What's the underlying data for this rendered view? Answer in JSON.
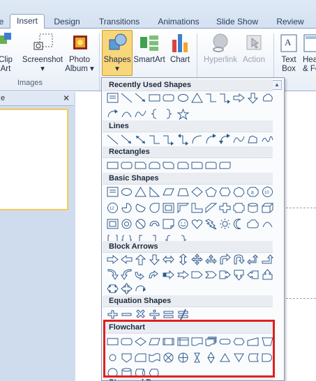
{
  "tabs": [
    {
      "label": "e",
      "active": false
    },
    {
      "label": "Insert",
      "active": true
    },
    {
      "label": "Design",
      "active": false
    },
    {
      "label": "Transitions",
      "active": false
    },
    {
      "label": "Animations",
      "active": false
    },
    {
      "label": "Slide Show",
      "active": false
    },
    {
      "label": "Review",
      "active": false
    }
  ],
  "ribbon": {
    "clip_art": {
      "line1": "Clip",
      "line2": "Art"
    },
    "screenshot": {
      "line1": "Screenshot",
      "line2": "▾"
    },
    "photo_album": {
      "line1": "Photo",
      "line2": "Album ▾"
    },
    "shapes": {
      "line1": "Shapes",
      "line2": "▾"
    },
    "smartart": {
      "label": "SmartArt"
    },
    "chart": {
      "label": "Chart"
    },
    "hyperlink": {
      "label": "Hyperlink"
    },
    "action": {
      "label": "Action"
    },
    "text_box": {
      "line1": "Text",
      "line2": "Box"
    },
    "header_footer": {
      "line1": "Header",
      "line2": "& Fo"
    },
    "images_group_label": "Images"
  },
  "left_panel": {
    "tab_label": "e",
    "close_glyph": "✕"
  },
  "dropdown": {
    "sections": [
      {
        "title": "Recently Used Shapes",
        "rows": [
          [
            "textbox",
            "line",
            "arrow-line",
            "rect",
            "rounded-rect",
            "oval",
            "triangle",
            "elbow",
            "elbow-arrow",
            "right-arrow",
            "down-arrow",
            "pentagon-ish"
          ],
          [
            "curve-arrow",
            "arc",
            "curve",
            "left-brace",
            "right-brace",
            "star"
          ]
        ]
      },
      {
        "title": "Lines",
        "rows": [
          [
            "line",
            "arrow-line",
            "double-arrow-line",
            "elbow",
            "elbow-arrow",
            "elbow-double",
            "curved-connector",
            "curved-arrow",
            "curved-double",
            "curve",
            "freeform",
            "scribble"
          ]
        ]
      },
      {
        "title": "Rectangles",
        "rows": [
          [
            "rect",
            "rounded-rect",
            "snip1",
            "snip2",
            "snip-diag",
            "snip-round",
            "round1",
            "round2",
            "round-diag"
          ]
        ]
      },
      {
        "title": "Basic Shapes",
        "rows": [
          [
            "textbox",
            "oval",
            "triangle",
            "right-triangle",
            "parallelogram",
            "trapezoid",
            "diamond",
            "pentagon",
            "hexagon",
            "heptagon",
            "octagon",
            "decagon"
          ],
          [
            "dodecagon",
            "pie",
            "chord",
            "teardrop",
            "frame",
            "half-frame",
            "l-shape",
            "diag-stripe",
            "cross",
            "plaque",
            "can",
            "cube"
          ],
          [
            "bevel",
            "donut",
            "no-symbol",
            "block-arc",
            "folded-corner",
            "smiley",
            "heart",
            "lightning",
            "sun",
            "moon",
            "cloud",
            "arc"
          ],
          [
            "double-bracket",
            "double-brace",
            "left-bracket",
            "right-bracket",
            "left-brace",
            "right-brace"
          ]
        ]
      },
      {
        "title": "Block Arrows",
        "rows": [
          [
            "right-arrow",
            "left-arrow",
            "up-arrow",
            "down-arrow",
            "left-right-arrow",
            "up-down-arrow",
            "quad-arrow",
            "left-right-up",
            "bent-arrow",
            "u-turn",
            "left-up-arrow",
            "bent-up-arrow"
          ],
          [
            "curved-right",
            "curved-left",
            "curved-up",
            "curved-down",
            "striped-right",
            "notched-right",
            "pentagon-arrow",
            "chevron",
            "right-callout",
            "down-callout",
            "left-callout",
            "up-callout"
          ],
          [
            "lr-callout",
            "quad-callout",
            "circular-arrow"
          ]
        ]
      },
      {
        "title": "Equation Shapes",
        "rows": [
          [
            "plus",
            "minus",
            "multiply",
            "divide",
            "equal",
            "not-equal"
          ]
        ]
      },
      {
        "title": "Flowchart",
        "rows": [
          [
            "process",
            "alt-process",
            "decision",
            "data",
            "predefined",
            "internal-storage",
            "document",
            "multidocument",
            "terminator",
            "preparation",
            "manual-input",
            "manual-operation"
          ],
          [
            "connector",
            "offpage",
            "card",
            "punched-tape",
            "summing",
            "or",
            "collate",
            "sort",
            "extract",
            "merge",
            "stored-data",
            "delay"
          ],
          [
            "seq-storage",
            "magnetic-disk",
            "direct-storage",
            "display"
          ]
        ]
      },
      {
        "title": "Stars and Banners",
        "rows": []
      }
    ]
  },
  "colors": {
    "ribbon_bg": "#dfe9f5",
    "shape_stroke": "#2f5b8e",
    "shape_fill": "#ffffff",
    "highlight": "#e02020",
    "active_button": "#f8d67a"
  }
}
